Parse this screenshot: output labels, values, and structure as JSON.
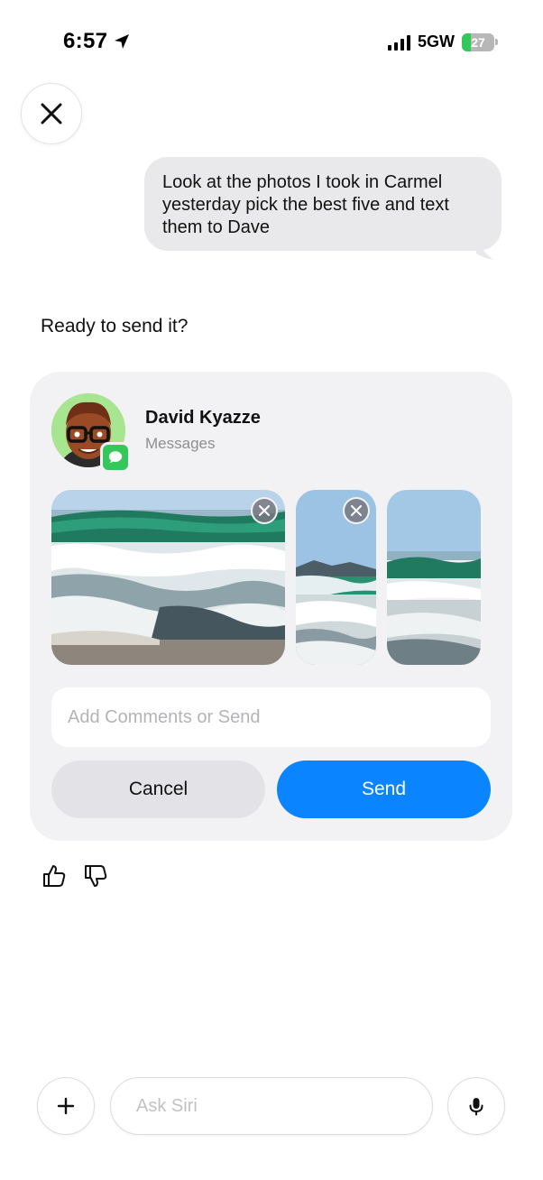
{
  "status_bar": {
    "time": "6:57",
    "network": "5GW",
    "battery_level": "27",
    "battery_fraction": 0.27
  },
  "conversation": {
    "user_message": "Look at the photos I took in Carmel yesterday pick the best five and text them to Dave",
    "assistant_prompt": "Ready to send it?"
  },
  "share_card": {
    "contact_name": "David Kyazze",
    "contact_app": "Messages",
    "comment_placeholder": "Add Comments or Send",
    "cancel_label": "Cancel",
    "send_label": "Send",
    "send_color": "#0a84ff"
  },
  "composer": {
    "placeholder": "Ask Siri"
  },
  "icons": [
    "location-arrow-icon",
    "signal-icon",
    "battery-icon",
    "close-icon",
    "messages-icon",
    "remove-photo-icon",
    "thumbs-up-icon",
    "thumbs-down-icon",
    "plus-icon",
    "microphone-icon"
  ]
}
